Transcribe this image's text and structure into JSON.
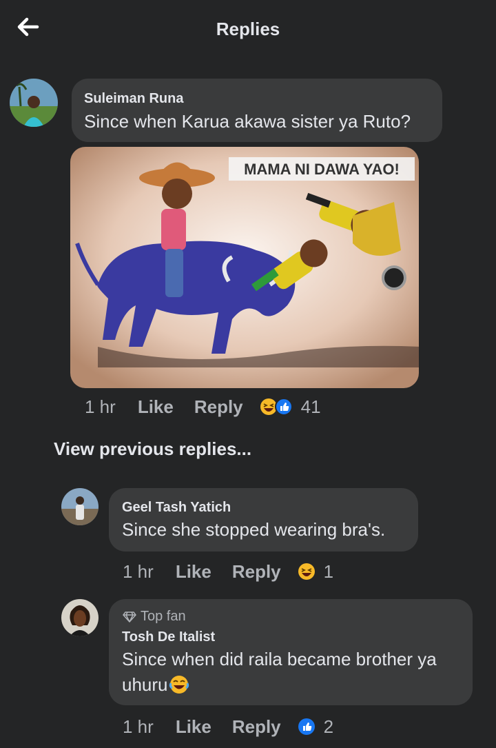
{
  "header": {
    "title": "Replies",
    "back_icon": "arrow-left-icon"
  },
  "root_comment": {
    "author": "Suleiman Runa",
    "text": "Since when Karua akawa sister ya Ruto?",
    "image_caption": "MAMA NI DAWA YAO!",
    "time": "1 hr",
    "like_label": "Like",
    "reply_label": "Reply",
    "reactions": [
      "haha-icon",
      "like-icon"
    ],
    "reaction_count": "41"
  },
  "view_previous": "View previous replies...",
  "replies": [
    {
      "author": "Geel Tash Yatich",
      "text": "Since she stopped wearing bra's.",
      "time": "1 hr",
      "like_label": "Like",
      "reply_label": "Reply",
      "reactions": [
        "haha-icon"
      ],
      "reaction_count": "1"
    },
    {
      "badge": "Top fan",
      "badge_icon": "diamond-icon",
      "author": "Tosh De Italist",
      "text_line1": "Since when did raila became brother ya",
      "text_line2": "uhuru",
      "text_emoji": "crying-laughing-emoji",
      "time": "1 hr",
      "like_label": "Like",
      "reply_label": "Reply",
      "reactions": [
        "like-icon"
      ],
      "reaction_count": "2"
    }
  ],
  "colors": {
    "background": "#242526",
    "bubble": "#3a3b3c",
    "text_primary": "#e4e6eb",
    "text_secondary": "#b0b3b8",
    "like_blue": "#1877f2",
    "haha_yellow": "#f7b928"
  }
}
